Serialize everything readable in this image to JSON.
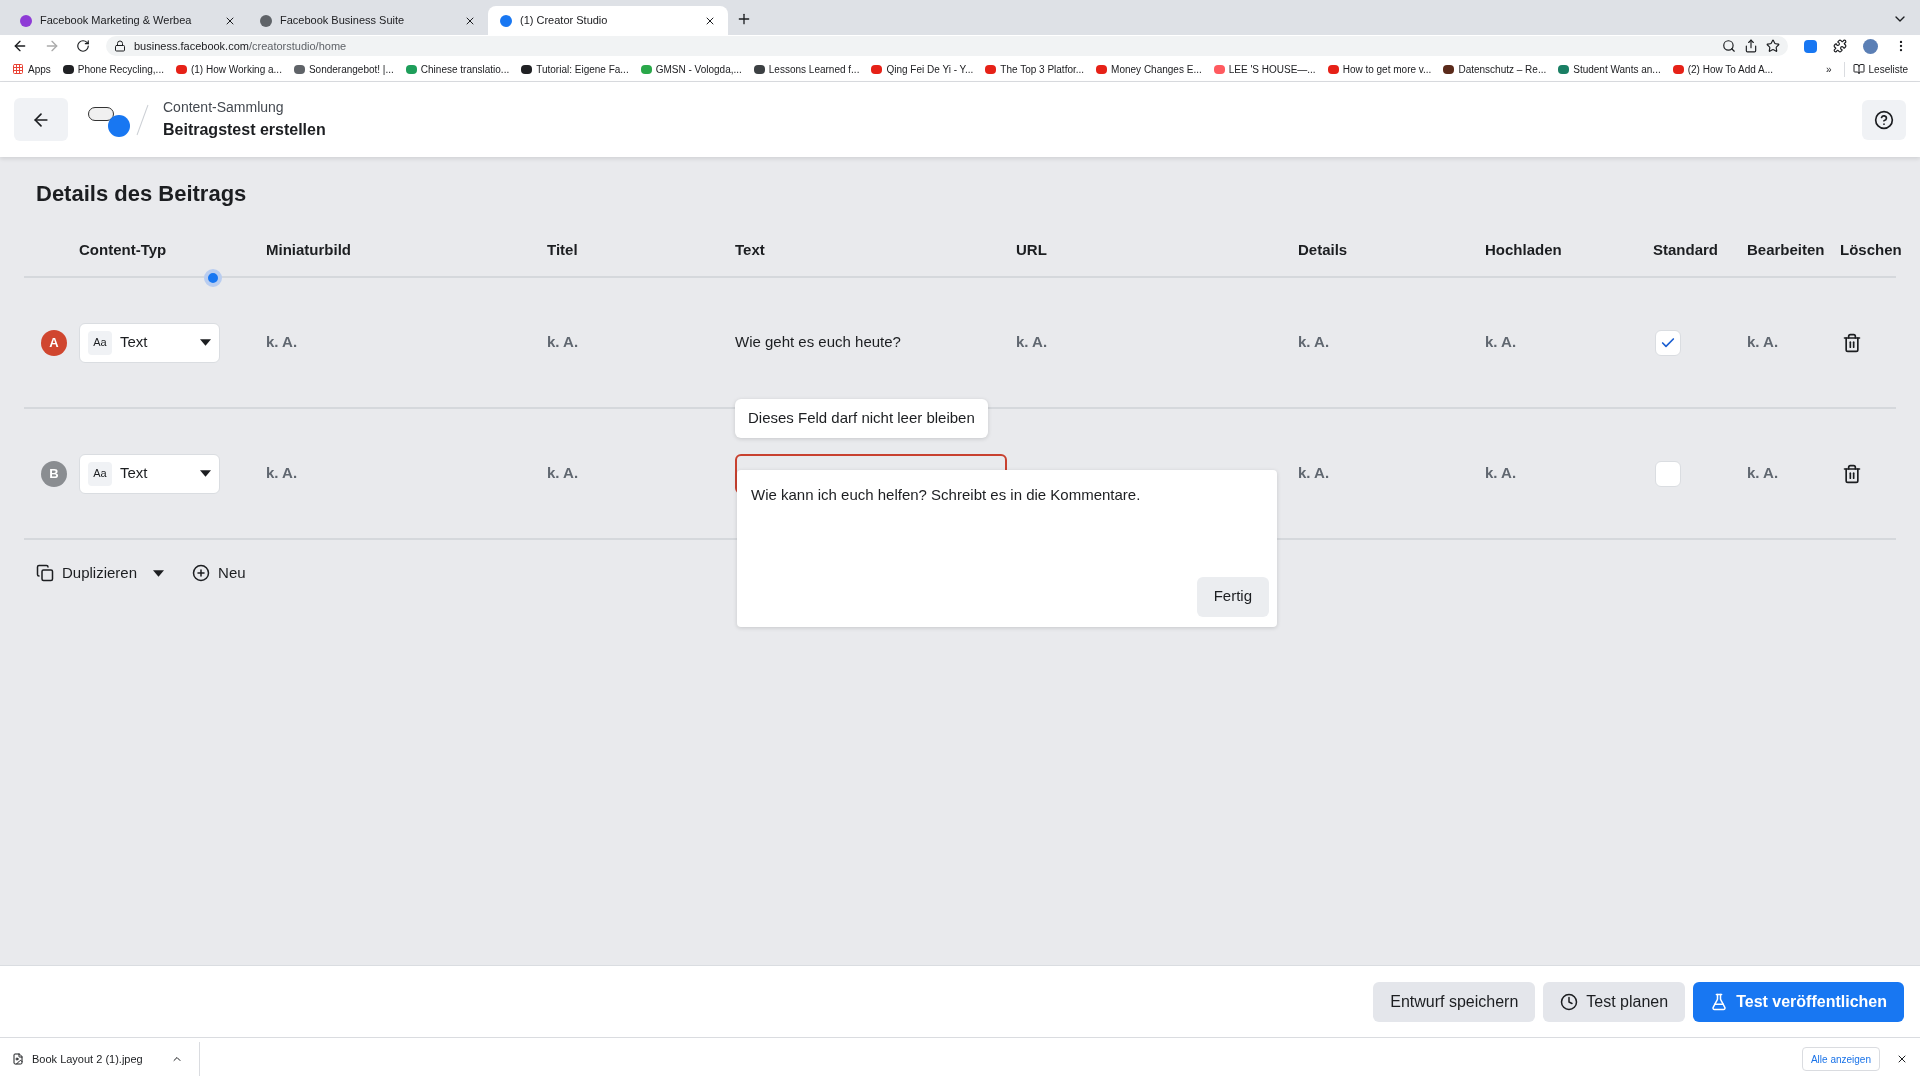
{
  "browser": {
    "tabs": [
      {
        "title": "Facebook Marketing & Werbea",
        "selected": false,
        "color": "#8e3bd6"
      },
      {
        "title": "Facebook Business Suite",
        "selected": false,
        "color": "#5f6368"
      },
      {
        "title": "(1) Creator Studio",
        "selected": true,
        "color": "#1877f2"
      }
    ],
    "address_host": "business.facebook.com",
    "address_path": "/creatorstudio/home",
    "apps_label": "Apps",
    "bookmarks": [
      {
        "label": "Phone Recycling,...",
        "color": "#202124"
      },
      {
        "label": "(1) How Working a...",
        "color": "#e62117"
      },
      {
        "label": "Sonderangebot! |...",
        "color": "#5f6368"
      },
      {
        "label": "Chinese translatio...",
        "color": "#1e9e5a"
      },
      {
        "label": "Tutorial: Eigene Fa...",
        "color": "#202124"
      },
      {
        "label": "GMSN - Vologda,...",
        "color": "#2aa84a"
      },
      {
        "label": "Lessons Learned f...",
        "color": "#3c4043"
      },
      {
        "label": "Qing Fei De Yi - Y...",
        "color": "#e62117"
      },
      {
        "label": "The Top 3 Platfor...",
        "color": "#e62117"
      },
      {
        "label": "Money Changes E...",
        "color": "#e62117"
      },
      {
        "label": "LEE 'S HOUSE—...",
        "color": "#ff5a5f"
      },
      {
        "label": "How to get more v...",
        "color": "#e62117"
      },
      {
        "label": "Datenschutz – Re...",
        "color": "#5a2a1a"
      },
      {
        "label": "Student Wants an...",
        "color": "#1a7f64"
      },
      {
        "label": "(2) How To Add A...",
        "color": "#e62117"
      }
    ],
    "bookmarks_overflow": "»",
    "reading_list": "Leseliste"
  },
  "header": {
    "breadcrumb": "Content-Sammlung",
    "title": "Beitragstest erstellen"
  },
  "section_title": "Details des Beitrags",
  "columns": [
    "Content-Typ",
    "Miniaturbild",
    "Titel",
    "Text",
    "URL",
    "Details",
    "Hochladen",
    "Standard",
    "Bearbeiten",
    "Löschen"
  ],
  "rows": [
    {
      "badge": "A",
      "color": "#d0462f",
      "type_icon": "Aa",
      "type": "Text",
      "thumbnail": "k. A.",
      "title": "k. A.",
      "text": {
        "kind": "text",
        "value": "Wie geht es euch heute?"
      },
      "url": "k. A.",
      "details": "k. A.",
      "upload": "k. A.",
      "standard": true,
      "edit": "k. A."
    },
    {
      "badge": "B",
      "color": "#8a8d91",
      "type_icon": "Aa",
      "type": "Text",
      "thumbnail": "k. A.",
      "title": "k. A.",
      "text": {
        "kind": "field",
        "invalid": true,
        "tooltip": "Dieses Feld darf nicht leer bleiben",
        "editor_value": "Wie kann ich euch helfen? Schreibt es in die Kommentare.",
        "editor_done": "Fertig"
      },
      "details": "k. A.",
      "upload": "k. A.",
      "standard": false,
      "edit": "k. A."
    }
  ],
  "actions": {
    "duplicate": "Duplizieren",
    "new": "Neu"
  },
  "footer_buttons": [
    {
      "label": "Entwurf speichern",
      "kind": "secondary"
    },
    {
      "label": "Test planen",
      "kind": "schedule"
    },
    {
      "label": "Test veröffentlichen",
      "kind": "primary"
    }
  ],
  "downloads": {
    "file": "Book Layout 2 (1).jpeg",
    "show_all": "Alle anzeigen"
  }
}
